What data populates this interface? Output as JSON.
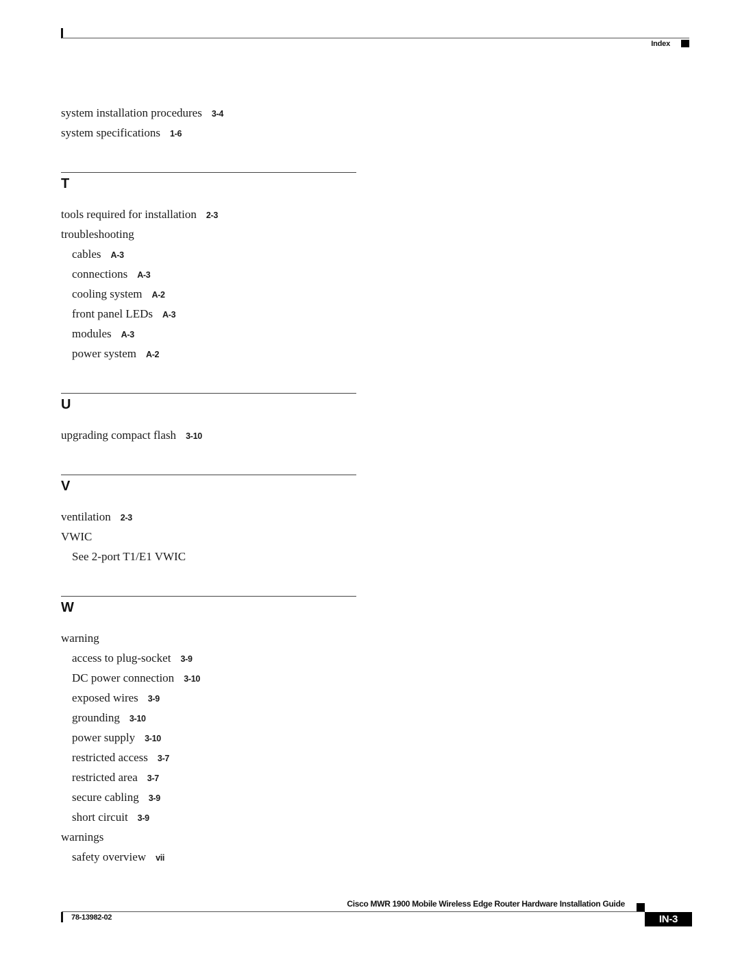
{
  "header": {
    "section_label": "Index"
  },
  "index": {
    "continued_entries": [
      {
        "term": "system installation procedures",
        "page": "3-4"
      },
      {
        "term": "system specifications",
        "page": "1-6"
      }
    ],
    "sections": [
      {
        "letter": "T",
        "entries": [
          {
            "term": "tools required for installation",
            "page": "2-3",
            "level": 0
          },
          {
            "term": "troubleshooting",
            "page": "",
            "level": 0
          },
          {
            "term": "cables",
            "page": "A-3",
            "level": 1
          },
          {
            "term": "connections",
            "page": "A-3",
            "level": 1
          },
          {
            "term": "cooling system",
            "page": "A-2",
            "level": 1
          },
          {
            "term": "front panel LEDs",
            "page": "A-3",
            "level": 1
          },
          {
            "term": "modules",
            "page": "A-3",
            "level": 1
          },
          {
            "term": "power system",
            "page": "A-2",
            "level": 1
          }
        ]
      },
      {
        "letter": "U",
        "entries": [
          {
            "term": "upgrading compact flash",
            "page": "3-10",
            "level": 0
          }
        ]
      },
      {
        "letter": "V",
        "entries": [
          {
            "term": "ventilation",
            "page": "2-3",
            "level": 0
          },
          {
            "term": "VWIC",
            "page": "",
            "level": 0
          },
          {
            "term": "See 2-port T1/E1 VWIC",
            "page": "",
            "level": 1
          }
        ]
      },
      {
        "letter": "W",
        "entries": [
          {
            "term": "warning",
            "page": "",
            "level": 0
          },
          {
            "term": "access to plug-socket",
            "page": "3-9",
            "level": 1
          },
          {
            "term": "DC power connection",
            "page": "3-10",
            "level": 1
          },
          {
            "term": "exposed wires",
            "page": "3-9",
            "level": 1
          },
          {
            "term": "grounding",
            "page": "3-10",
            "level": 1
          },
          {
            "term": "power supply",
            "page": "3-10",
            "level": 1
          },
          {
            "term": "restricted access",
            "page": "3-7",
            "level": 1
          },
          {
            "term": "restricted area",
            "page": "3-7",
            "level": 1
          },
          {
            "term": "secure cabling",
            "page": "3-9",
            "level": 1
          },
          {
            "term": "short circuit",
            "page": "3-9",
            "level": 1
          },
          {
            "term": "warnings",
            "page": "",
            "level": 0
          },
          {
            "term": "safety overview",
            "page": "vii",
            "level": 1
          }
        ]
      }
    ]
  },
  "footer": {
    "guide_title": "Cisco MWR 1900 Mobile Wireless Edge Router Hardware Installation Guide",
    "doc_number": "78-13982-02",
    "page_number": "IN-3"
  }
}
